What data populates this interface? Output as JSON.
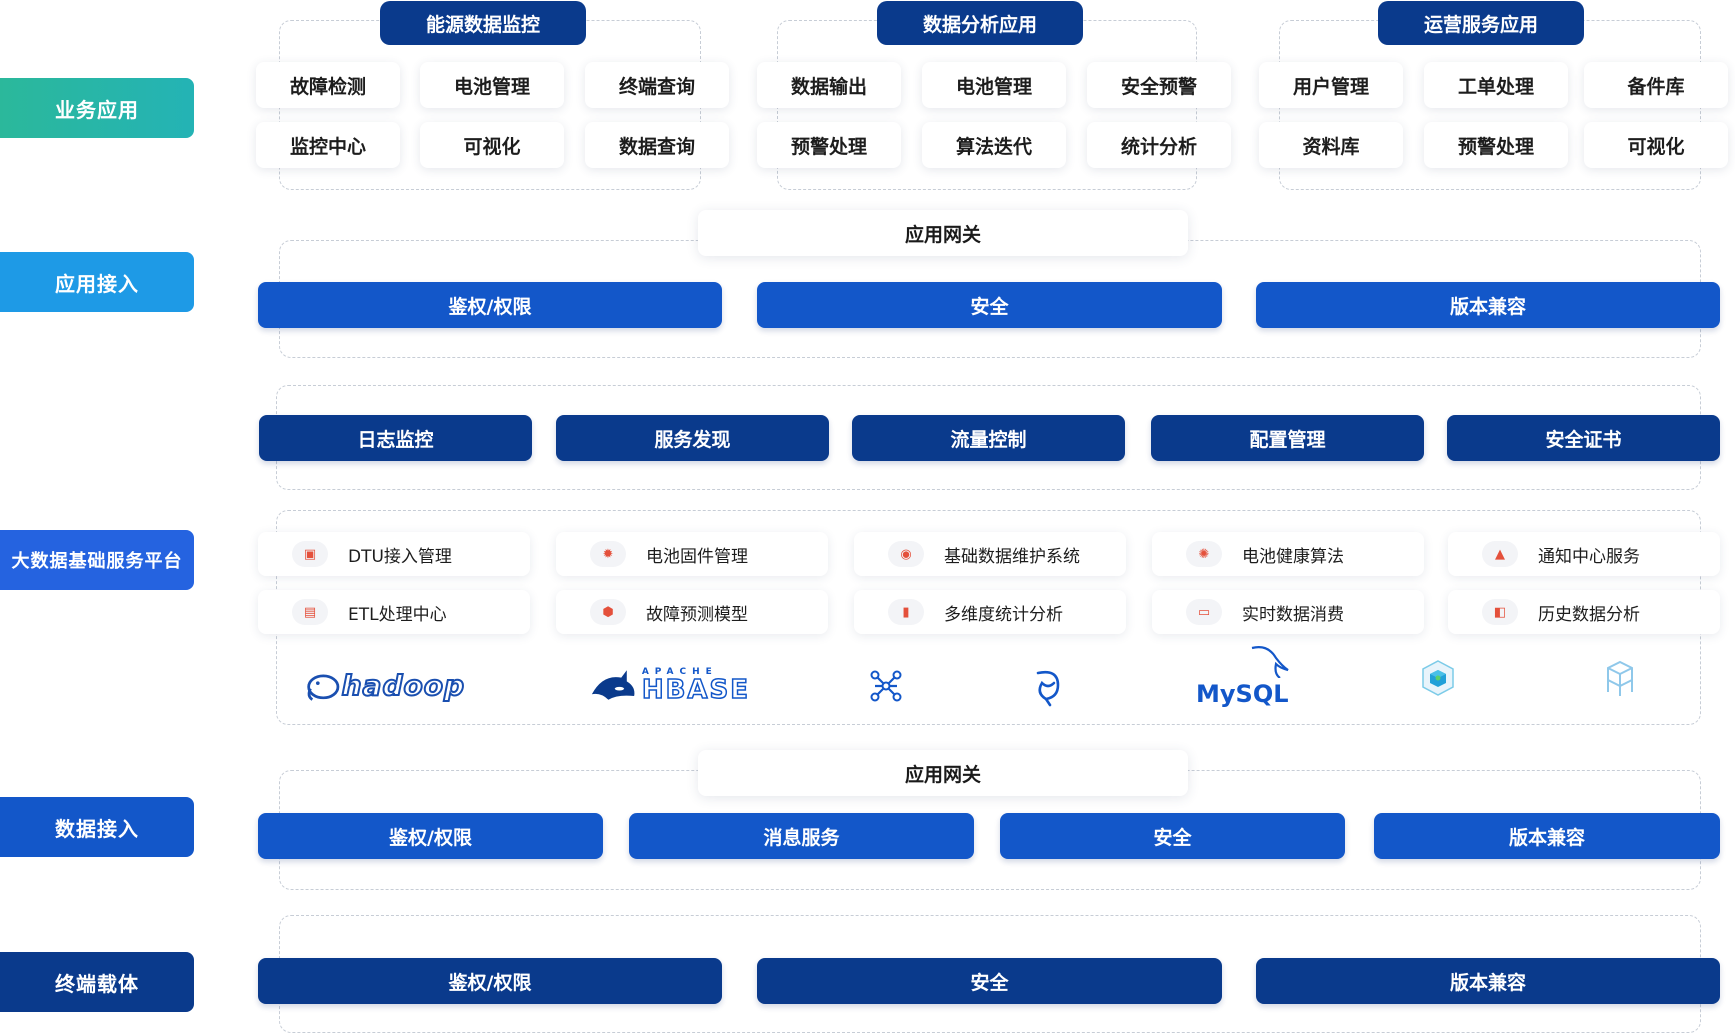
{
  "layers": {
    "business": "业务应用",
    "app_access": "应用接入",
    "platform": "大数据基础服务平台",
    "data_access": "数据接入",
    "terminal": "终端载体"
  },
  "colors": {
    "business": "#26b5a3",
    "app_access": "#1e9ae6",
    "platform": "#2563e0",
    "data_access": "#1357c9",
    "terminal": "#0a3a8c"
  },
  "business_groups": [
    {
      "title": "能源数据监控",
      "items": [
        "故障检测",
        "电池管理",
        "终端查询",
        "监控中心",
        "可视化",
        "数据查询"
      ]
    },
    {
      "title": "数据分析应用",
      "items": [
        "数据输出",
        "电池管理",
        "安全预警",
        "预警处理",
        "算法迭代",
        "统计分析"
      ]
    },
    {
      "title": "运营服务应用",
      "items": [
        "用户管理",
        "工单处理",
        "备件库",
        "资料库",
        "预警处理",
        "可视化"
      ]
    }
  ],
  "app_access": {
    "gateway": "应用网关",
    "bars": [
      "鉴权/权限",
      "安全",
      "版本兼容"
    ]
  },
  "platform": {
    "top_bars": [
      "日志监控",
      "服务发现",
      "流量控制",
      "配置管理",
      "安全证书"
    ],
    "services": [
      {
        "icon": "dtu-icon",
        "label": "DTU接入管理"
      },
      {
        "icon": "gear-icon",
        "label": "电池固件管理"
      },
      {
        "icon": "database-icon",
        "label": "基础数据维护系统"
      },
      {
        "icon": "settings-icon",
        "label": "电池健康算法"
      },
      {
        "icon": "bell-icon",
        "label": "通知中心服务"
      },
      {
        "icon": "etl-icon",
        "label": "ETL处理中心"
      },
      {
        "icon": "shield-icon",
        "label": "故障预测模型"
      },
      {
        "icon": "bar-chart-icon",
        "label": "多维度统计分析"
      },
      {
        "icon": "monitor-icon",
        "label": "实时数据消费"
      },
      {
        "icon": "clipboard-icon",
        "label": "历史数据分析"
      }
    ],
    "logos": {
      "hadoop": "hadoop",
      "hbase_top": "APACHE",
      "hbase": "HBASE",
      "mysql": "MySQL"
    }
  },
  "data_access": {
    "gateway": "应用网关",
    "bars": [
      "鉴权/权限",
      "消息服务",
      "安全",
      "版本兼容"
    ]
  },
  "terminal": {
    "bars": [
      "鉴权/权限",
      "安全",
      "版本兼容"
    ]
  }
}
